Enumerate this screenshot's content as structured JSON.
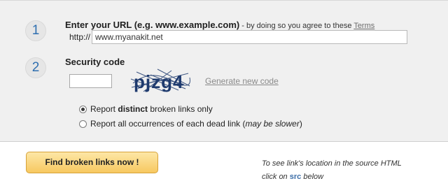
{
  "steps": {
    "one": "1",
    "two": "2"
  },
  "url_section": {
    "heading_bold": "Enter your URL (e.g. www.example.com)",
    "heading_normal": " - by doing so you agree to these ",
    "terms_link": "Terms",
    "prefix": "http://",
    "value": "www.myanakit.net"
  },
  "security_section": {
    "heading": "Security code",
    "captcha_text": "pjzg4",
    "code_value": "",
    "generate_link": "Generate new code"
  },
  "options": {
    "opt1_before": "Report ",
    "opt1_bold": "distinct",
    "opt1_after": " broken links only",
    "opt2_before": "Report all occurrences of each dead link (",
    "opt2_italic": "may be slower",
    "opt2_after": ")",
    "selected": 1
  },
  "actions": {
    "find_button": "Find broken links now !"
  },
  "hint": {
    "line1": "To see link's location in the source HTML",
    "line2_before": "click on ",
    "src": "src",
    "line2_after": " below"
  },
  "colors": {
    "accent_blue": "#2f6fb0",
    "button_gold": "#f7c860",
    "panel_gray": "#f0f0f0"
  }
}
